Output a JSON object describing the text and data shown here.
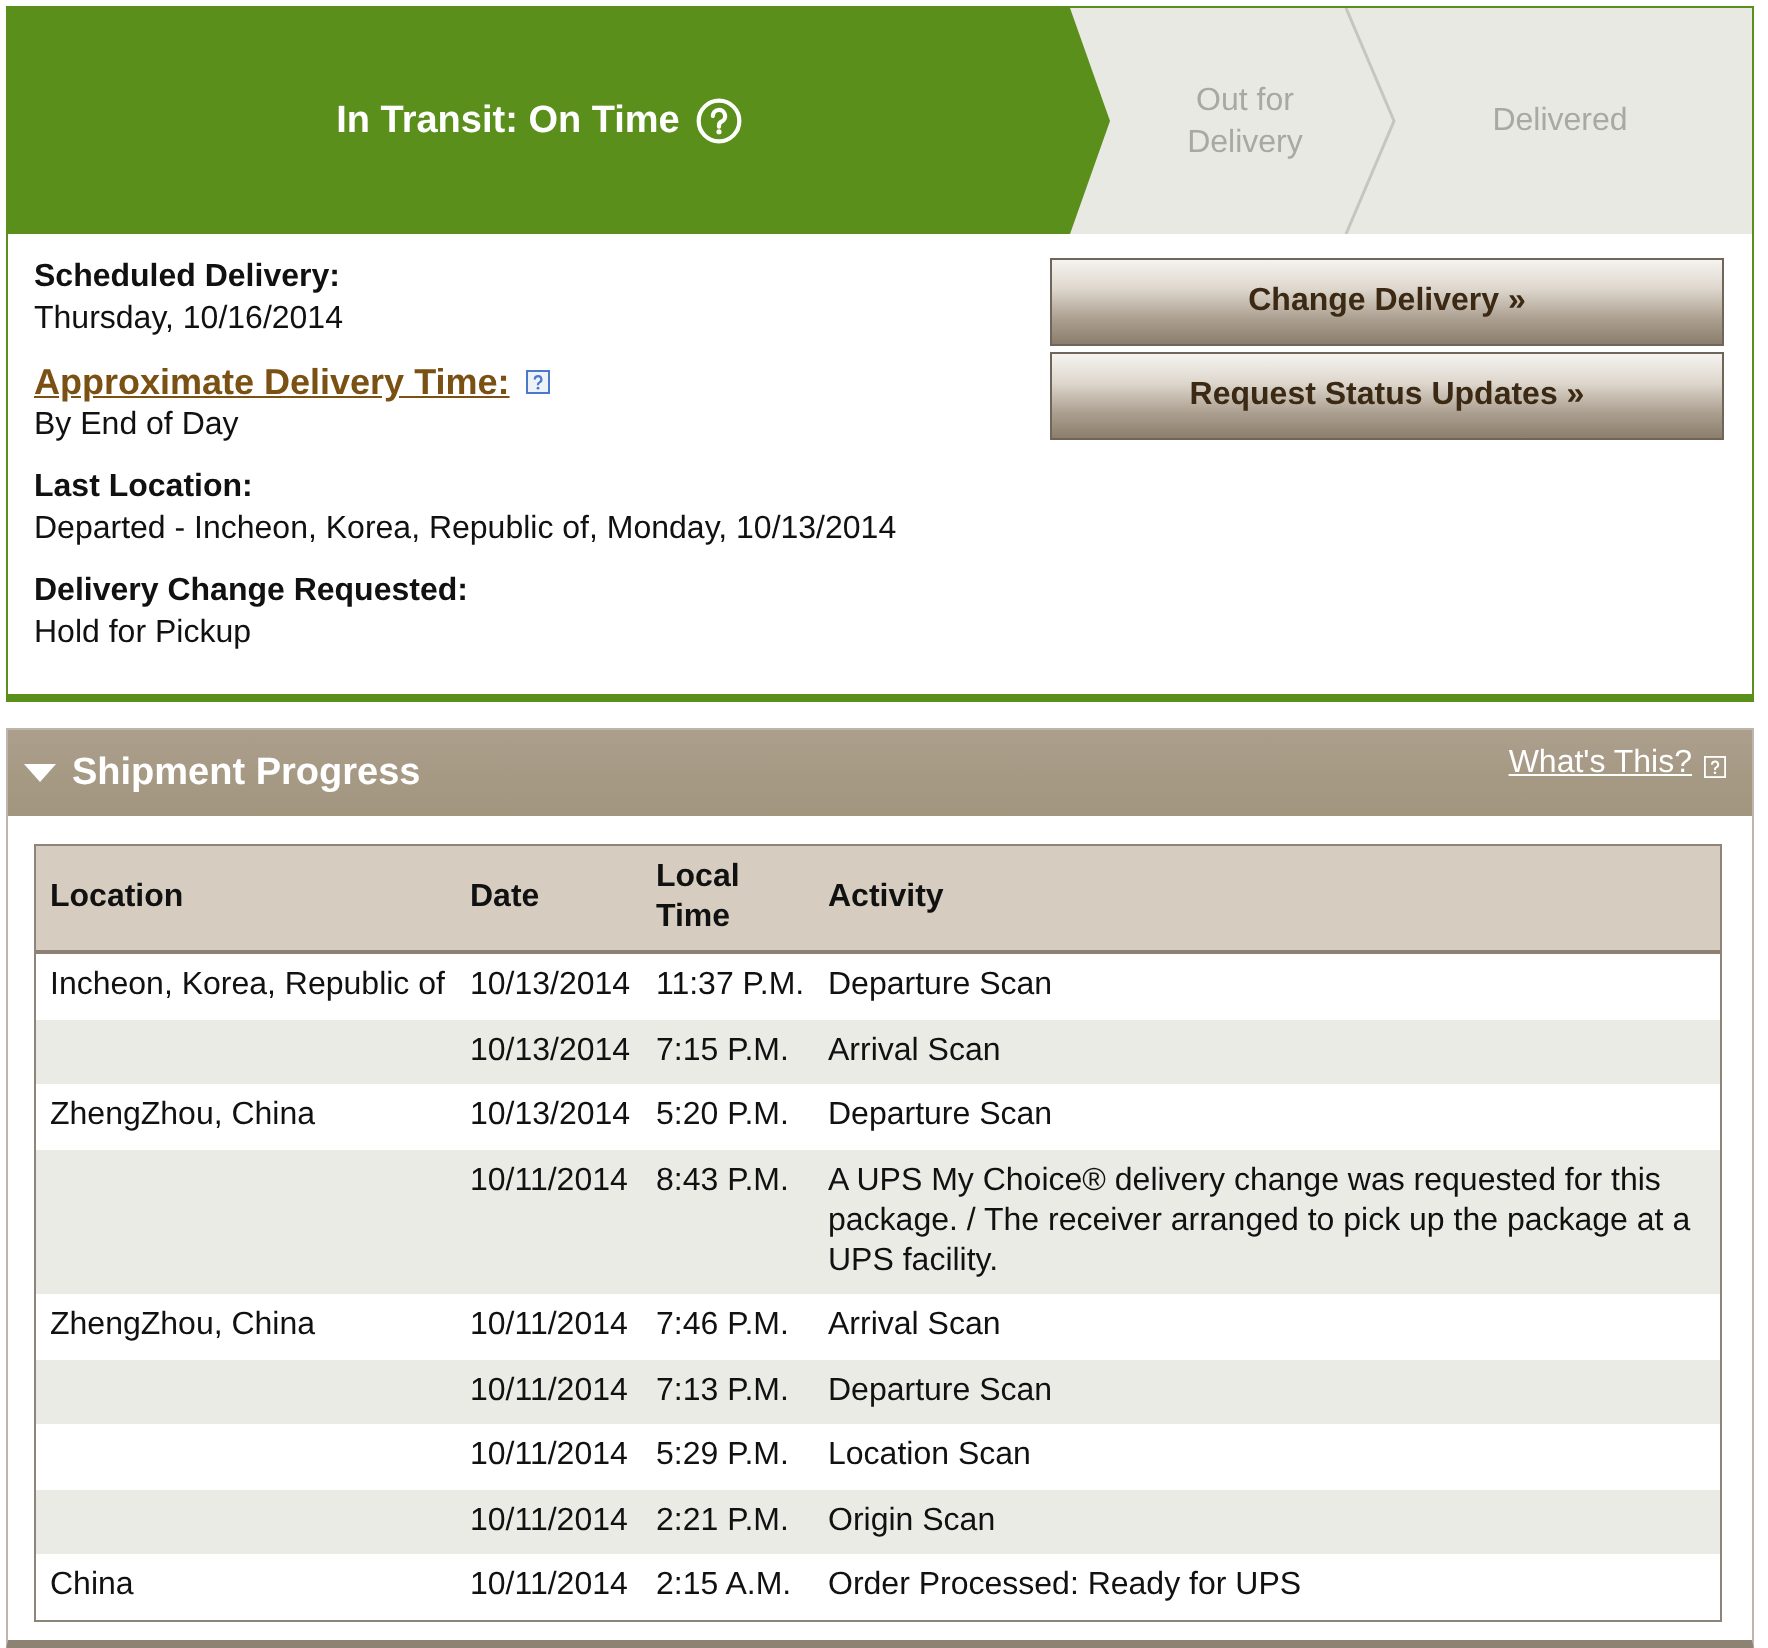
{
  "tracker": {
    "steps": [
      {
        "label": "In Transit: On Time",
        "current": true,
        "help": true
      },
      {
        "label": "Out for Delivery",
        "current": false
      },
      {
        "label": "Delivered",
        "current": false
      }
    ]
  },
  "details": [
    {
      "kind": "plain",
      "label": "Scheduled Delivery:",
      "value": "Thursday, 10/16/2014"
    },
    {
      "kind": "link",
      "label": "Approximate Delivery Time:",
      "value": "By End of Day",
      "help": true
    },
    {
      "kind": "plain",
      "label": "Last Location:",
      "value": "Departed - Incheon, Korea, Republic of, Monday, 10/13/2014"
    },
    {
      "kind": "plain",
      "label": "Delivery Change Requested:",
      "value": "Hold for Pickup"
    }
  ],
  "actions": [
    "Change Delivery »",
    "Request Status Updates »"
  ],
  "shipment_progress": {
    "title": "Shipment Progress",
    "expanded": true,
    "help_link": "What's This?",
    "table": {
      "columns": [
        "Location",
        "Date",
        "Local Time",
        "Activity"
      ],
      "rows": [
        {
          "location": "Incheon, Korea, Republic of",
          "date": "10/13/2014",
          "local_time": "11:37 P.M.",
          "activity": "Departure Scan"
        },
        {
          "date": "10/13/2014",
          "local_time": "7:15 P.M.",
          "activity": "Arrival Scan"
        },
        {
          "location": "ZhengZhou, China",
          "date": "10/13/2014",
          "local_time": "5:20 P.M.",
          "activity": "Departure Scan"
        },
        {
          "date": "10/11/2014",
          "local_time": "8:43 P.M.",
          "activity": "A UPS My Choice® delivery change was requested for this package. / The receiver arranged to pick up the package at a UPS facility."
        },
        {
          "location": "ZhengZhou, China",
          "date": "10/11/2014",
          "local_time": "7:46 P.M.",
          "activity": "Arrival Scan"
        },
        {
          "date": "10/11/2014",
          "local_time": "7:13 P.M.",
          "activity": "Departure Scan"
        },
        {
          "date": "10/11/2014",
          "local_time": "5:29 P.M.",
          "activity": "Location Scan"
        },
        {
          "date": "10/11/2014",
          "local_time": "2:21 P.M.",
          "activity": "Origin Scan"
        },
        {
          "location": "China",
          "date": "10/11/2014",
          "local_time": "2:15 A.M.",
          "activity": "Order Processed: Ready for UPS"
        }
      ]
    }
  }
}
